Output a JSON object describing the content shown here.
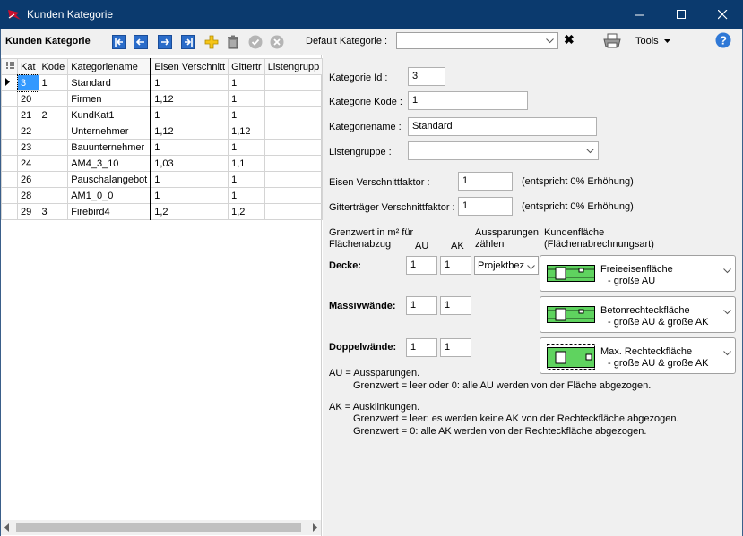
{
  "window": {
    "title": "Kunden Kategorie"
  },
  "toolbar": {
    "label": "Kunden Kategorie",
    "default_label": "Default Kategorie :",
    "default_value": "",
    "clear": "✖",
    "tools": "Tools"
  },
  "grid": {
    "columns": [
      "Kat",
      "Kode",
      "Kategoriename",
      "Eisen Verschnitt",
      "Gittertr",
      "Listengrupp"
    ],
    "rows": [
      {
        "kat": "3",
        "kode": "1",
        "name": "Standard",
        "eisen": "1",
        "gitter": "1",
        "liste": ""
      },
      {
        "kat": "20",
        "kode": "",
        "name": "Firmen",
        "eisen": "1,12",
        "gitter": "1",
        "liste": ""
      },
      {
        "kat": "21",
        "kode": "2",
        "name": "KundKat1",
        "eisen": "1",
        "gitter": "1",
        "liste": ""
      },
      {
        "kat": "22",
        "kode": "",
        "name": "Unternehmer",
        "eisen": "1,12",
        "gitter": "1,12",
        "liste": ""
      },
      {
        "kat": "23",
        "kode": "",
        "name": "Bauunternehmer",
        "eisen": "1",
        "gitter": "1",
        "liste": ""
      },
      {
        "kat": "24",
        "kode": "",
        "name": "AM4_3_10",
        "eisen": "1,03",
        "gitter": "1,1",
        "liste": ""
      },
      {
        "kat": "26",
        "kode": "",
        "name": "Pauschalangebot",
        "eisen": "1",
        "gitter": "1",
        "liste": ""
      },
      {
        "kat": "28",
        "kode": "",
        "name": "AM1_0_0",
        "eisen": "1",
        "gitter": "1",
        "liste": ""
      },
      {
        "kat": "29",
        "kode": "3",
        "name": "Firebird4",
        "eisen": "1,2",
        "gitter": "1,2",
        "liste": ""
      }
    ]
  },
  "detail": {
    "id_label": "Kategorie Id :",
    "id_value": "3",
    "kode_label": "Kategorie Kode :",
    "kode_value": "1",
    "name_label": "Kategoriename :",
    "name_value": "Standard",
    "liste_label": "Listengruppe :",
    "liste_value": "",
    "eisen_label": "Eisen Verschnittfaktor :",
    "eisen_value": "1",
    "eisen_note": "(entspricht 0% Erhöhung)",
    "gitter_label": "Gitterträger Verschnittfaktor :",
    "gitter_value": "1",
    "gitter_note": "(entspricht 0% Erhöhung)",
    "grenz_header_1": "Grenzwert in m² für",
    "grenz_header_2": "Flächenabzug",
    "au_header": "AU",
    "ak_header": "AK",
    "aussp_header_1": "Aussparungen",
    "aussp_header_2": "zählen",
    "kf_header_1": "Kundenfläche",
    "kf_header_2": "(Flächenabrechnungsart)",
    "decke_label": "Decke:",
    "decke_au": "1",
    "decke_ak": "1",
    "decke_aussp": "Projektbez",
    "decke_flaeche_1": "Freieeisenfläche",
    "decke_flaeche_2": "- große AU",
    "massiv_label": "Massivwände:",
    "massiv_au": "1",
    "massiv_ak": "1",
    "massiv_flaeche_1": "Betonrechteckfläche",
    "massiv_flaeche_2": "- große AU & große AK",
    "doppel_label": "Doppelwände:",
    "doppel_au": "1",
    "doppel_ak": "1",
    "doppel_flaeche_1": "Max. Rechteckfläche",
    "doppel_flaeche_2": "- große AU & große AK",
    "note_au_1": "AU = Aussparungen.",
    "note_au_2": "Grenzwert = leer oder 0:  alle AU werden von der Fläche abgezogen.",
    "note_ak_1": "AK = Ausklinkungen.",
    "note_ak_2": "Grenzwert = leer: es werden keine AK von der Rechteckfläche abgezogen.",
    "note_ak_3": "Grenzwert = 0:  alle AK werden von der Rechteckfläche abgezogen."
  }
}
